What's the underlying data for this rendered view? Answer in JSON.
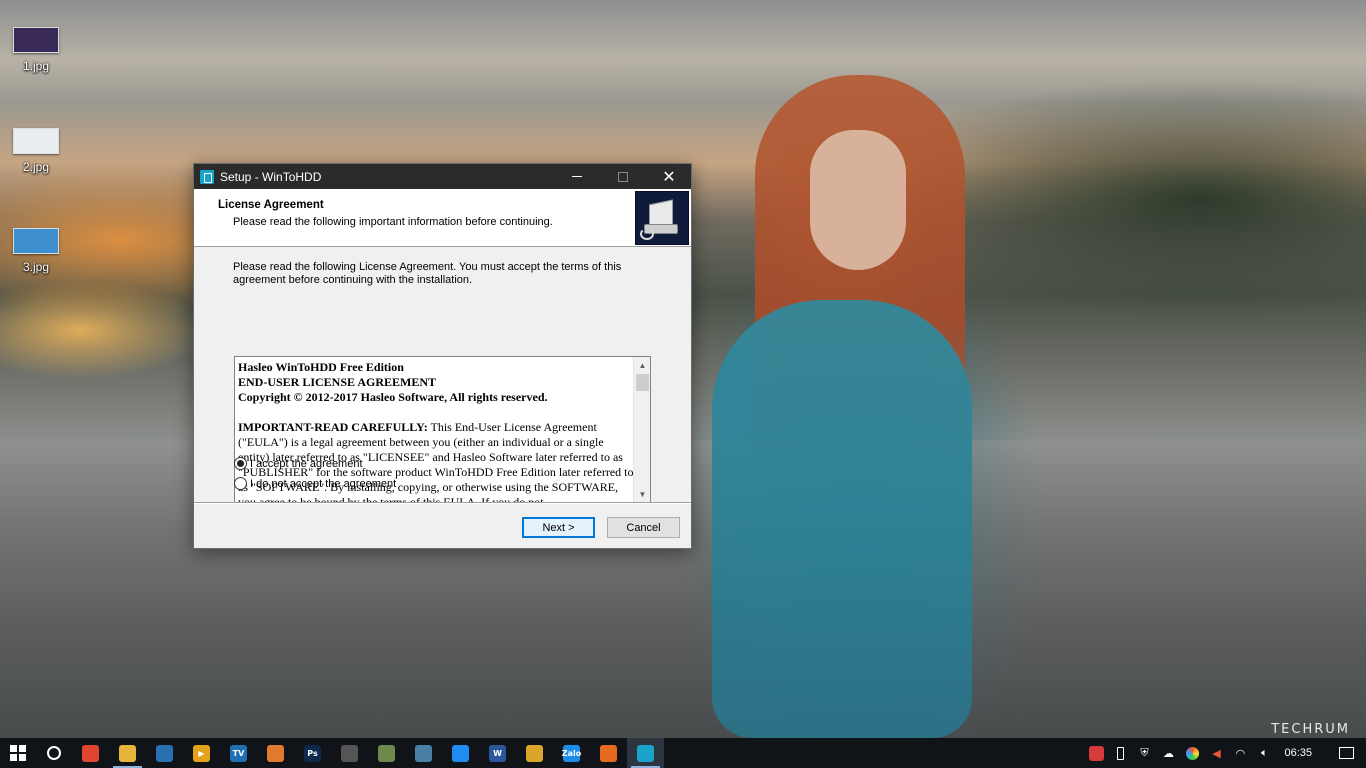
{
  "desktop": {
    "icons": [
      {
        "label": "1.jpg",
        "thumb_color": "#3a2a5a"
      },
      {
        "label": "2.jpg",
        "thumb_color": "#e8eef2"
      },
      {
        "label": "3.jpg",
        "thumb_color": "#3d8fd0"
      }
    ],
    "watermark": "TECHRUM"
  },
  "dialog": {
    "title": "Setup - WinToHDD",
    "header_title": "License Agreement",
    "header_subtitle": "Please read the following important information before continuing.",
    "intro": "Please read the following License Agreement. You must accept the terms of this agreement before continuing with the installation.",
    "eula": {
      "line1": "Hasleo WinToHDD Free Edition",
      "line2": "END-USER LICENSE AGREEMENT",
      "line3": "Copyright © 2012-2017 Hasleo Software, All rights reserved.",
      "lead_bold": "IMPORTANT-READ CAREFULLY:",
      "lead_rest": " This End-User License Agreement (\"EULA\") is a legal agreement between you (either an individual or a single entity) later referred to as \"LICENSEE\" and Hasleo Software later referred to as \"PUBLISHER\" for the software product WinToHDD Free Edition later referred to as \"SOFTWARE\". By installing, copying, or otherwise using the SOFTWARE, you agree to be bound by the terms of this EULA. If you do not"
    },
    "radio_accept": "I accept the agreement",
    "radio_decline": "I do not accept the agreement",
    "accept_selected": true,
    "next_label": "Next >",
    "cancel_label": "Cancel"
  },
  "taskbar": {
    "apps": [
      {
        "name": "chrome-canary",
        "color": "#e0452f",
        "glyph": ""
      },
      {
        "name": "file-explorer",
        "color": "#e7b53c",
        "glyph": ""
      },
      {
        "name": "virtualbox",
        "color": "#2a6fb0",
        "glyph": ""
      },
      {
        "name": "media-player",
        "color": "#e3a21a",
        "glyph": "▶"
      },
      {
        "name": "go-tv",
        "color": "#1f6fb5",
        "glyph": "TV"
      },
      {
        "name": "sublime-app",
        "color": "#e07a2c",
        "glyph": ""
      },
      {
        "name": "photoshop",
        "color": "#0e2a4a",
        "glyph": "Ps"
      },
      {
        "name": "davinci",
        "color": "#555555",
        "glyph": ""
      },
      {
        "name": "paint-app",
        "color": "#6c8a4b",
        "glyph": ""
      },
      {
        "name": "network-app",
        "color": "#4a7fa5",
        "glyph": ""
      },
      {
        "name": "messenger",
        "color": "#1e8cf0",
        "glyph": ""
      },
      {
        "name": "word",
        "color": "#2b579a",
        "glyph": "W"
      },
      {
        "name": "chrome",
        "color": "#d9a52a",
        "glyph": ""
      },
      {
        "name": "zalo",
        "color": "#1a8ee8",
        "glyph": "Zalo"
      },
      {
        "name": "firefox",
        "color": "#e66a1f",
        "glyph": ""
      },
      {
        "name": "wintohdd",
        "color": "#19a3c9",
        "glyph": ""
      }
    ],
    "tray": {
      "icons": [
        "vivaldi-icon",
        "usb-icon",
        "shield-icon",
        "cloud-sync-icon",
        "colorful-icon",
        "volume-muted-icon",
        "wifi-icon",
        "speaker-icon"
      ],
      "clock": "06:35"
    }
  }
}
